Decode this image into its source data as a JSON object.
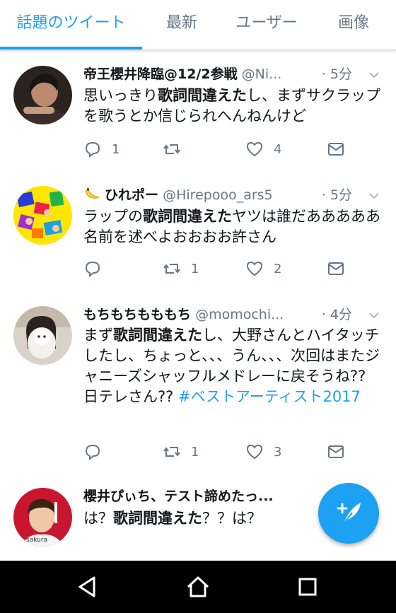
{
  "tabs": [
    {
      "label": "話題のツイート",
      "active": true
    },
    {
      "label": "最新",
      "active": false
    },
    {
      "label": "ユーザー",
      "active": false
    },
    {
      "label": "画像",
      "active": false
    }
  ],
  "tweets": [
    {
      "name": "帝王櫻井降臨@12/2参戦",
      "handle": "@Ni...",
      "time": "· 5分",
      "text_parts": [
        {
          "t": "思いっきり",
          "bold": false
        },
        {
          "t": "歌詞間違えた",
          "bold": true
        },
        {
          "t": "し、まずサクラップを歌うとか信じられへんねんけど",
          "bold": false
        }
      ],
      "replies": "1",
      "retweets": "",
      "likes": "4"
    },
    {
      "name_prefix_icon": "banana-emoji",
      "name": "ひれポー",
      "handle": "@Hirepooo_ars5",
      "time": "· 5分",
      "text_parts": [
        {
          "t": "ラップの",
          "bold": false
        },
        {
          "t": "歌詞間違えた",
          "bold": true
        },
        {
          "t": "ヤツは誰だあああああ名前を述べよおおおお許さん",
          "bold": false
        }
      ],
      "replies": "",
      "retweets": "1",
      "likes": "2"
    },
    {
      "name": "もちもちもももち",
      "handle": "@momochi...",
      "time": "· 4分",
      "text_parts": [
        {
          "t": "まず",
          "bold": false
        },
        {
          "t": "歌詞間違えた",
          "bold": true
        },
        {
          "t": "し、大野さんとハイタッチしたし、ちょっと、、、うん、、、次回はまたジャニーズシャッフルメドレーに戻そうね??日テレさん?? ",
          "bold": false
        },
        {
          "t": "#ベストアーティスト2017",
          "bold": false,
          "hashtag": true
        }
      ],
      "replies": "",
      "retweets": "1",
      "likes": "3"
    },
    {
      "name": "櫻井ぴぃち、テスト諦めたっ...",
      "handle": "",
      "time": "",
      "text_parts": [
        {
          "t": "は？",
          "bold": false
        },
        {
          "t": "歌詞間違えた",
          "bold": true
        },
        {
          "t": "？？は？",
          "bold": false
        }
      ],
      "avatar_text": "sakura"
    }
  ],
  "colors": {
    "accent": "#1da1f2",
    "secondary_text": "#657786",
    "divider": "#e1e8ed"
  },
  "icons": [
    "reply-icon",
    "retweet-icon",
    "like-icon",
    "direct-message-icon",
    "caret-down-icon",
    "compose-tweet-icon",
    "back-icon",
    "home-icon",
    "recents-icon"
  ]
}
